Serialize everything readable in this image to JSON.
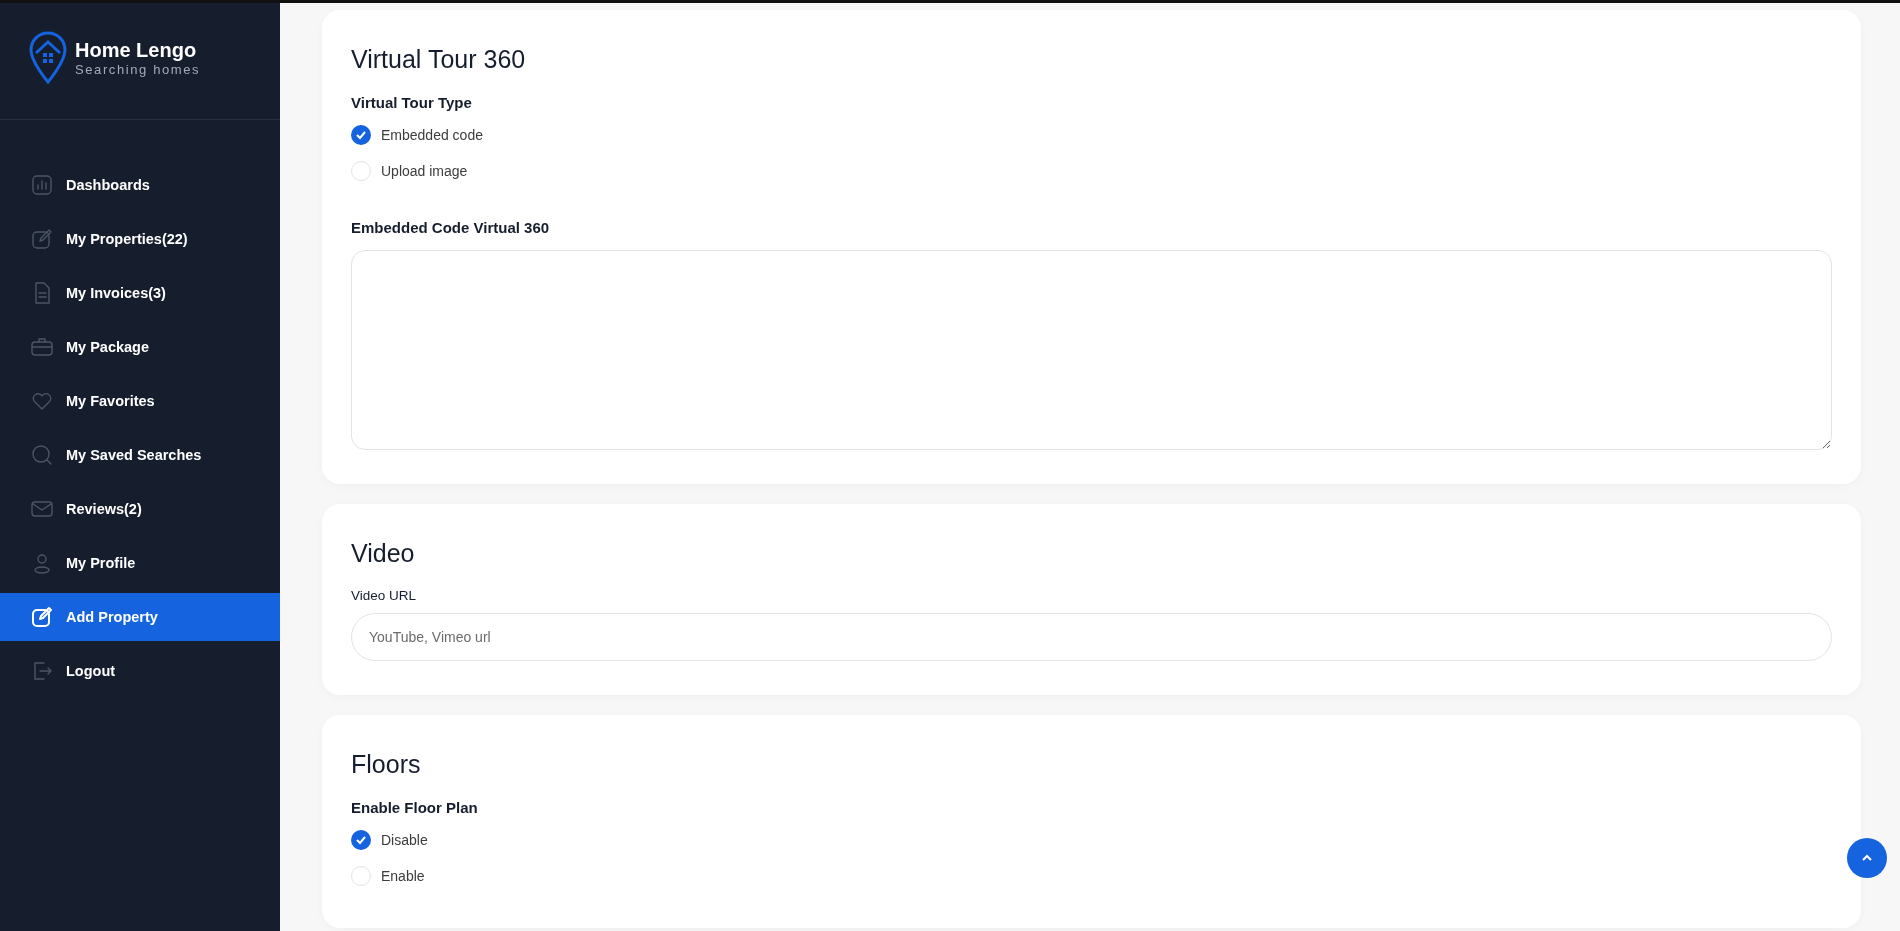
{
  "sidebar": {
    "logo": {
      "title": "Home Lengo",
      "subtitle": "Searching homes"
    },
    "items": [
      {
        "label": "Dashboards",
        "selected": false
      },
      {
        "label": "My Properties(22)",
        "selected": false
      },
      {
        "label": "My Invoices(3)",
        "selected": false
      },
      {
        "label": "My Package",
        "selected": false
      },
      {
        "label": "My Favorites",
        "selected": false
      },
      {
        "label": "My Saved Searches",
        "selected": false
      },
      {
        "label": "Reviews(2)",
        "selected": false
      },
      {
        "label": "My Profile",
        "selected": false
      },
      {
        "label": "Add Property",
        "selected": true
      },
      {
        "label": "Logout",
        "selected": false
      }
    ]
  },
  "sections": [
    {
      "title": "Virtual Tour 360",
      "fields": [
        {
          "kind": "radio",
          "label": "Virtual Tour Type",
          "options": [
            {
              "label": "Embedded code",
              "selected": true
            },
            {
              "label": "Upload image",
              "selected": false
            }
          ]
        },
        {
          "kind": "textarea",
          "label": "Embedded Code Virtual 360"
        }
      ]
    },
    {
      "title": "Video",
      "fields": [
        {
          "kind": "input",
          "label": "Video URL",
          "placeholder": "YouTube, Vimeo url"
        }
      ]
    },
    {
      "title": "Floors",
      "fields": [
        {
          "kind": "radio",
          "label": "Enable Floor Plan",
          "options": [
            {
              "label": "Disable",
              "selected": true
            },
            {
              "label": "Enable",
              "selected": false
            }
          ]
        }
      ]
    }
  ]
}
